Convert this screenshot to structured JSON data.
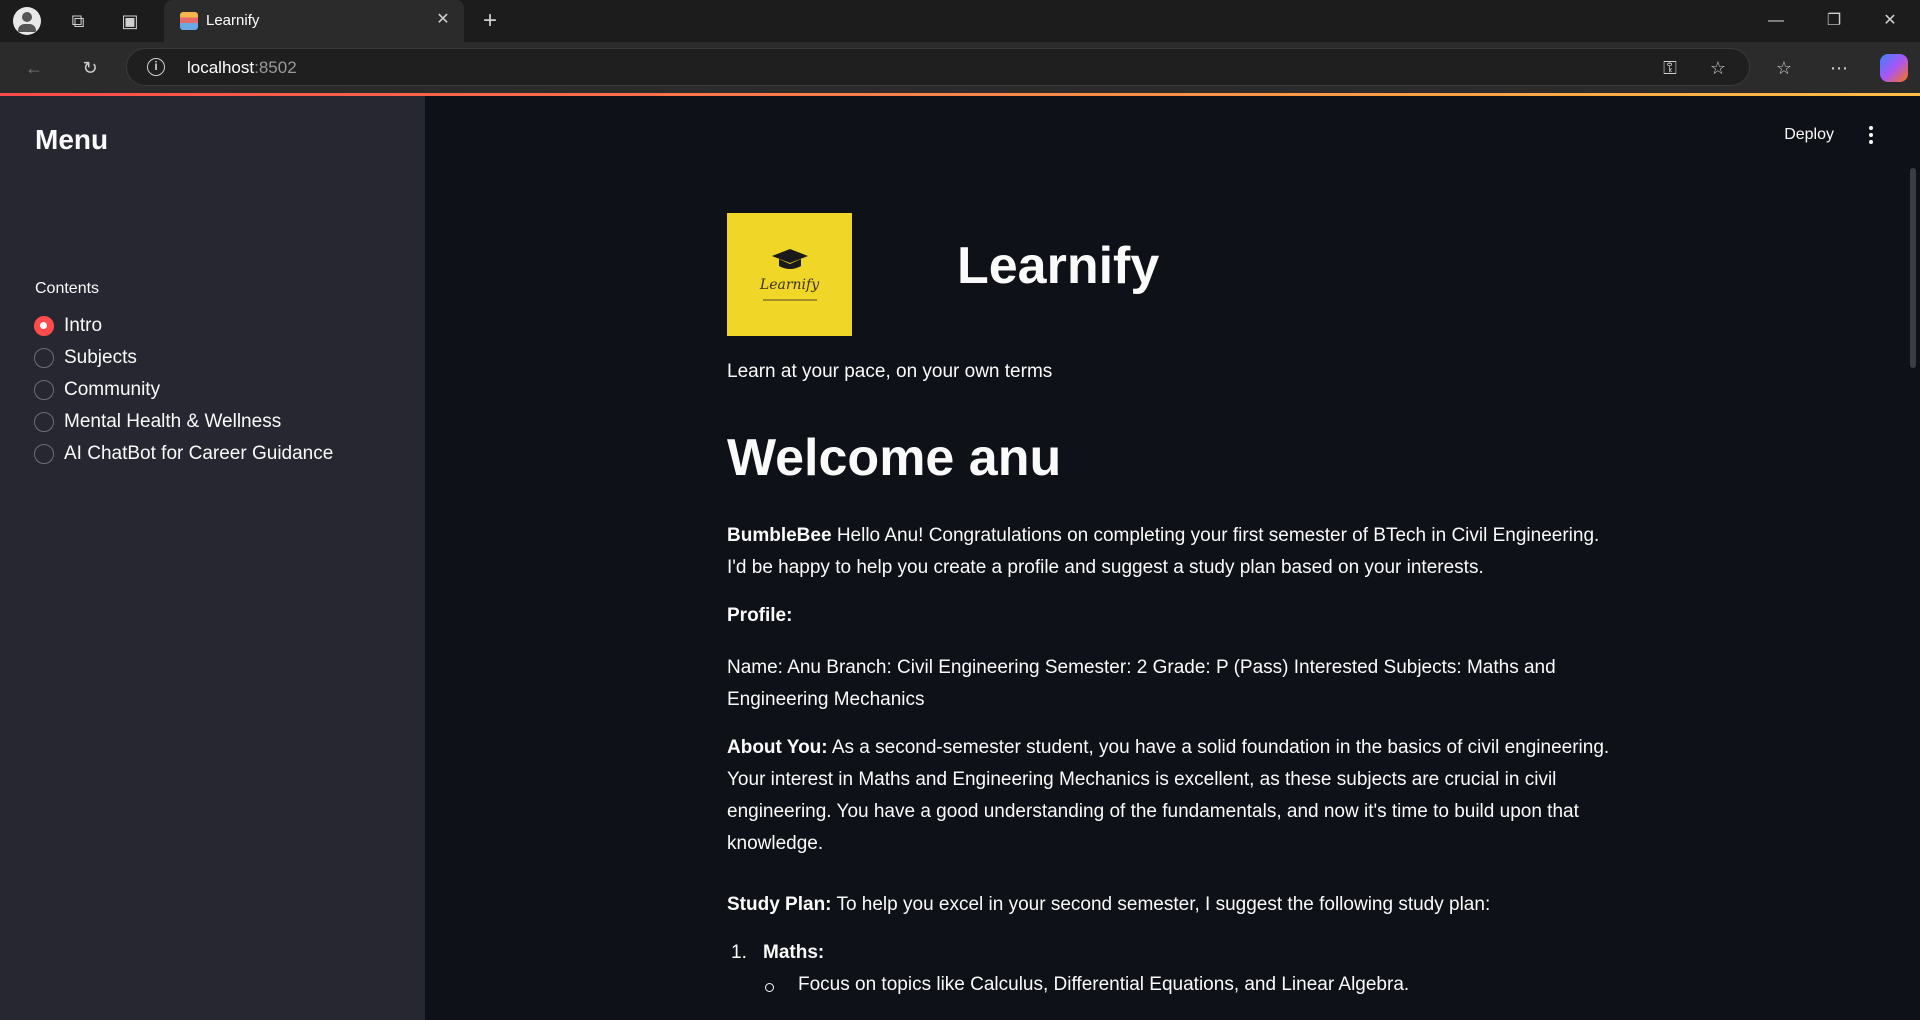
{
  "browser": {
    "tab_title": "Learnify",
    "url_host": "localhost",
    "url_port": ":8502",
    "icons": [
      "profile-icon",
      "workspaces-icon",
      "tab-actions-icon",
      "close-tab-icon",
      "new-tab-icon",
      "minimize-icon",
      "restore-icon",
      "close-window-icon",
      "back-icon",
      "refresh-icon",
      "info-icon",
      "key-icon",
      "favorite-star-icon",
      "favorites-icon",
      "more-icon",
      "copilot-icon"
    ]
  },
  "sidebar": {
    "title": "Menu",
    "radio_label": "Contents",
    "items": [
      {
        "label": "Intro",
        "selected": true
      },
      {
        "label": "Subjects",
        "selected": false
      },
      {
        "label": "Community",
        "selected": false
      },
      {
        "label": "Mental Health & Wellness",
        "selected": false
      },
      {
        "label": "AI ChatBot for Career Guidance",
        "selected": false
      }
    ]
  },
  "header": {
    "deploy_label": "Deploy"
  },
  "main": {
    "logo_text": "Learnify",
    "app_title": "Learnify",
    "tagline": "Learn at your pace, on your own terms",
    "welcome": "Welcome anu",
    "bot_name": "BumbleBee",
    "bot_message": "Hello Anu! Congratulations on completing your first semester of BTech in Civil Engineering. I'd be happy to help you create a profile and suggest a study plan based on your interests.",
    "profile_heading": "Profile:",
    "profile_text": "Name: Anu Branch: Civil Engineering Semester: 2 Grade: P (Pass) Interested Subjects: Maths and Engineering Mechanics",
    "about_heading": "About You:",
    "about_text": "As a second-semester student, you have a solid foundation in the basics of civil engineering. Your interest in Maths and Engineering Mechanics is excellent, as these subjects are crucial in civil engineering. You have a good understanding of the fundamentals, and now it's time to build upon that knowledge.",
    "plan_heading": "Study Plan:",
    "plan_text": "To help you excel in your second semester, I suggest the following study plan:",
    "plan_items": [
      {
        "number": "1.",
        "title": "Maths:",
        "bullets": [
          "Focus on topics like Calculus, Differential Equations, and Linear Algebra."
        ]
      }
    ]
  },
  "colors": {
    "accent": "#ff4b4b",
    "sidebar_bg": "#262730",
    "main_bg": "#0e1117",
    "logo_bg": "#f0d627"
  }
}
